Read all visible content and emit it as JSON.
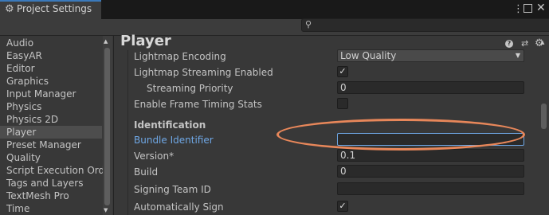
{
  "window": {
    "tab_title": "Project Settings",
    "menu_glyph": "⋮",
    "close_glyph": "✕"
  },
  "search": {
    "placeholder": ""
  },
  "sidebar": {
    "items": [
      {
        "label": "Audio"
      },
      {
        "label": "EasyAR"
      },
      {
        "label": "Editor"
      },
      {
        "label": "Graphics"
      },
      {
        "label": "Input Manager"
      },
      {
        "label": "Physics"
      },
      {
        "label": "Physics 2D"
      },
      {
        "label": "Player"
      },
      {
        "label": "Preset Manager"
      },
      {
        "label": "Quality"
      },
      {
        "label": "Script Execution Orde"
      },
      {
        "label": "Tags and Layers"
      },
      {
        "label": "TextMesh Pro"
      },
      {
        "label": "Time"
      }
    ],
    "selected": "Player"
  },
  "main": {
    "title": "Player",
    "rows": {
      "lightmap_encoding": {
        "label": "Lightmap Encoding",
        "value": "Low Quality"
      },
      "lightmap_streaming": {
        "label": "Lightmap Streaming Enabled",
        "checked": true
      },
      "streaming_priority": {
        "label": "Streaming Priority",
        "value": "0"
      },
      "frame_timing": {
        "label": "Enable Frame Timing Stats",
        "checked": false
      },
      "identification_header": "Identification",
      "bundle_identifier": {
        "label": "Bundle Identifier",
        "value": ""
      },
      "version": {
        "label": "Version*",
        "value": "0.1"
      },
      "build": {
        "label": "Build",
        "value": "0"
      },
      "signing_team": {
        "label": "Signing Team ID",
        "value": ""
      },
      "auto_sign": {
        "label": "Automatically Sign",
        "checked": true
      }
    }
  },
  "colors": {
    "highlight_label": "#6fa8e6",
    "annotation": "#e8875a"
  }
}
